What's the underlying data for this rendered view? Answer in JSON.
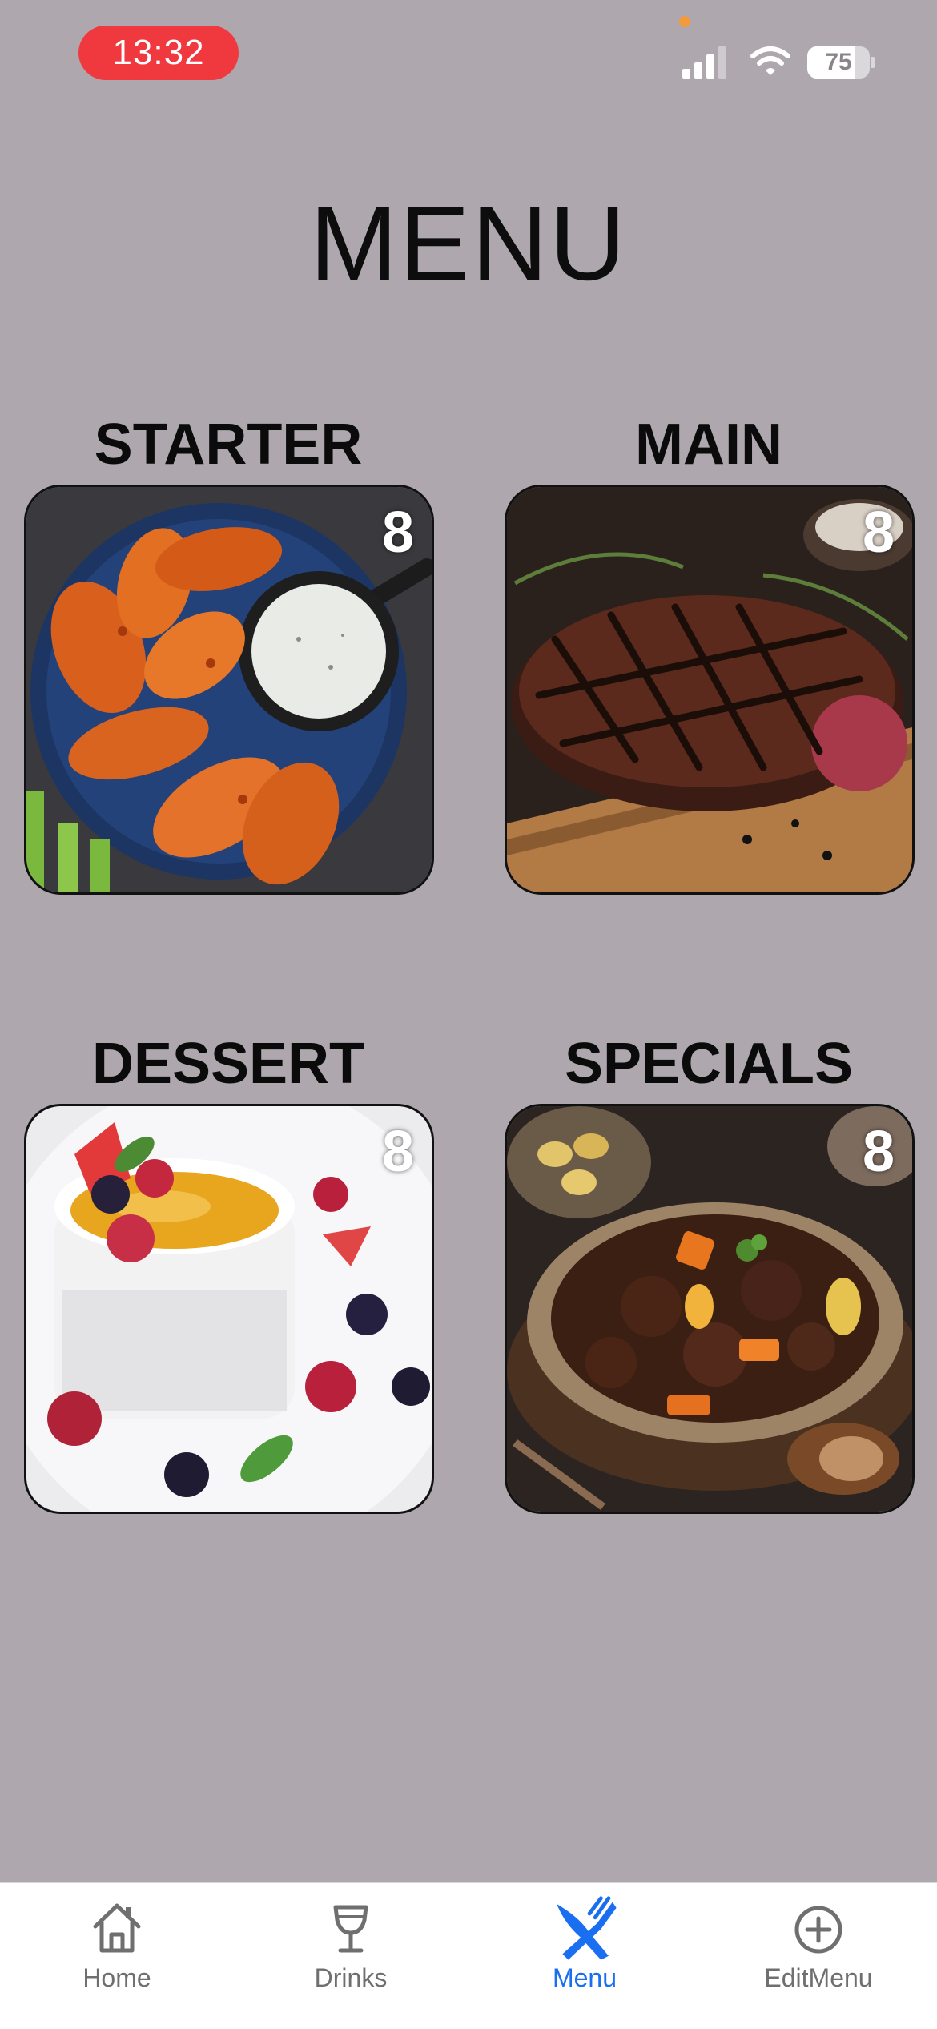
{
  "status_bar": {
    "time": "13:32",
    "battery_level": "75",
    "battery_fraction": 0.75
  },
  "title": "MENU",
  "categories": [
    {
      "label": "STARTER",
      "count": "8",
      "image": "chicken-wings"
    },
    {
      "label": "MAIN",
      "count": "8",
      "image": "grilled-steak"
    },
    {
      "label": "DESSERT",
      "count": "8",
      "image": "creme-brulee"
    },
    {
      "label": "SPECIALS",
      "count": "8",
      "image": "beef-stew"
    }
  ],
  "tab_bar": {
    "tabs": [
      {
        "label": "Home",
        "icon": "house-icon"
      },
      {
        "label": "Drinks",
        "icon": "wine-glass-icon"
      },
      {
        "label": "Menu",
        "icon": "fork-knife-icon"
      },
      {
        "label": "EditMenu",
        "icon": "plus-circle-icon"
      }
    ],
    "active": "Menu"
  },
  "colors": {
    "background": "#aea8ae",
    "time_pill": "#f0383f",
    "active_tab": "#1a6ef0",
    "inactive_tab": "#6f6f6f"
  }
}
